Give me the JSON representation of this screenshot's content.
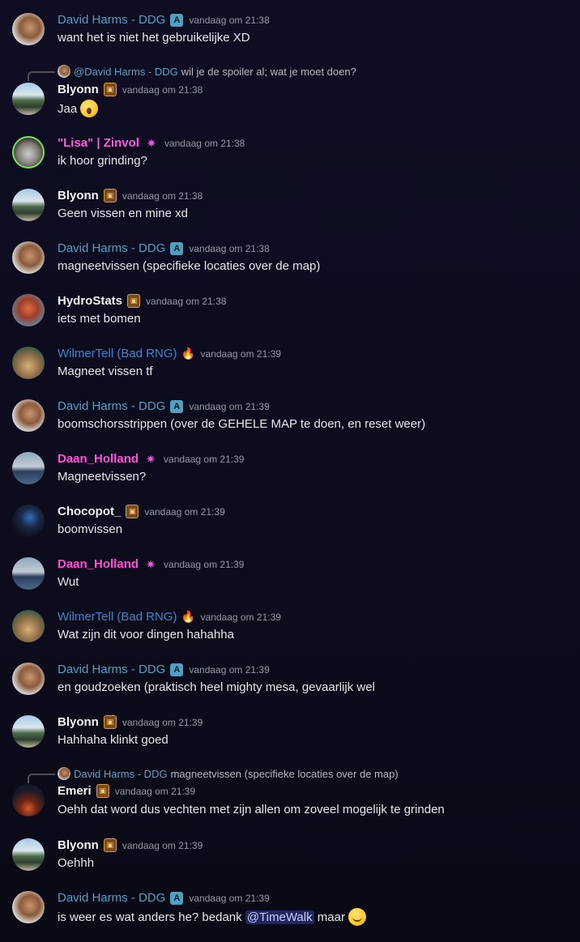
{
  "badges": {
    "a": "A",
    "lib": "▣",
    "star": "✷",
    "flame": "🔥"
  },
  "messages": [
    {
      "author": "David Harms - DDG",
      "time": "vandaag om 21:38",
      "text": "want het is niet het gebruikelijke XD"
    },
    {
      "reply_author": "@David Harms - DDG",
      "reply_text": "wil je de spoiler al; wat je moet doen?",
      "author": "Blyonn",
      "time": "vandaag om 21:38",
      "text": "Jaa"
    },
    {
      "author": "\"Lisa\" | Zinvol",
      "time": "vandaag om 21:38",
      "text": "ik hoor grinding?"
    },
    {
      "author": "Blyonn",
      "time": "vandaag om 21:38",
      "text": "Geen vissen en mine xd"
    },
    {
      "author": "David Harms - DDG",
      "time": "vandaag om 21:38",
      "text": "magneetvissen (specifieke locaties over de map)"
    },
    {
      "author": "HydroStats",
      "time": "vandaag om 21:38",
      "text": "iets met bomen"
    },
    {
      "author": "WilmerTell (Bad RNG)",
      "time": "vandaag om 21:39",
      "text": "Magneet vissen tf"
    },
    {
      "author": "David Harms - DDG",
      "time": "vandaag om 21:39",
      "text": "boomschorsstrippen (over de GEHELE MAP te doen, en reset weer)"
    },
    {
      "author": "Daan_Holland",
      "time": "vandaag om 21:39",
      "text": "Magneetvissen?"
    },
    {
      "author": "Chocopot_",
      "time": "vandaag om 21:39",
      "text": "boomvissen"
    },
    {
      "author": "Daan_Holland",
      "time": "vandaag om 21:39",
      "text": "Wut"
    },
    {
      "author": "WilmerTell (Bad RNG)",
      "time": "vandaag om 21:39",
      "text": "Wat zijn dit voor dingen hahahha"
    },
    {
      "author": "David Harms - DDG",
      "time": "vandaag om 21:39",
      "text": "en goudzoeken (praktisch heel mighty mesa, gevaarlijk wel"
    },
    {
      "author": "Blyonn",
      "time": "vandaag om 21:39",
      "text": "Hahhaha klinkt goed"
    },
    {
      "reply_author": "David Harms - DDG",
      "reply_text": "magneetvissen (specifieke locaties over de map)",
      "author": "Emeri",
      "time": "vandaag om 21:39",
      "text": "Oehh dat word dus vechten met zijn allen om zoveel mogelijk te grinden"
    },
    {
      "author": "Blyonn",
      "time": "vandaag om 21:39",
      "text": "Oehhh"
    },
    {
      "author": "David Harms - DDG",
      "time": "vandaag om 21:39",
      "text_before": "is weer es wat anders he? bedank ",
      "mention": "@TimeWalk",
      "text_after": " maar"
    }
  ],
  "colors": {
    "david": "#4fa1c3",
    "white_name": "#f2f3f5",
    "lisa": "#ff5be0",
    "daan": "#ff4fd9",
    "wilmer": "#3f86c9",
    "timestamp": "#949ba4"
  }
}
